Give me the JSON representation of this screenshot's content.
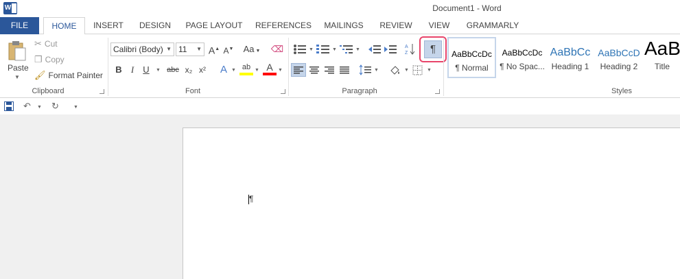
{
  "window": {
    "title": "Document1 - Word",
    "app_icon_letter": "W"
  },
  "tabs": [
    "FILE",
    "HOME",
    "INSERT",
    "DESIGN",
    "PAGE LAYOUT",
    "REFERENCES",
    "MAILINGS",
    "REVIEW",
    "VIEW",
    "GRAMMARLY"
  ],
  "active_tab": "HOME",
  "clipboard": {
    "paste": "Paste",
    "cut": "Cut",
    "copy": "Copy",
    "format_painter": "Format Painter",
    "label": "Clipboard"
  },
  "font": {
    "name": "Calibri (Body)",
    "size": "11",
    "grow": "A",
    "shrink": "A",
    "case": "Aa",
    "bold": "B",
    "italic": "I",
    "underline": "U",
    "strike": "abc",
    "subscript": "x₂",
    "superscript": "x²",
    "effects": "A",
    "highlight": "ab",
    "color": "A",
    "label": "Font",
    "highlight_color": "#ffff00",
    "font_color": "#ff0000"
  },
  "paragraph": {
    "show_marks": "¶",
    "label": "Paragraph"
  },
  "styles": {
    "items": [
      {
        "preview": "AaBbCcDc",
        "name": "¶ Normal"
      },
      {
        "preview": "AaBbCcDc",
        "name": "¶ No Spac..."
      },
      {
        "preview": "AaBbCc",
        "name": "Heading 1"
      },
      {
        "preview": "AaBbCcD",
        "name": "Heading 2"
      },
      {
        "preview": "AaB",
        "name": "Title"
      }
    ],
    "label": "Styles"
  },
  "document": {
    "paragraph_mark": "¶"
  },
  "colors": {
    "accent": "#2b579a",
    "highlight_border": "#e8446a"
  }
}
